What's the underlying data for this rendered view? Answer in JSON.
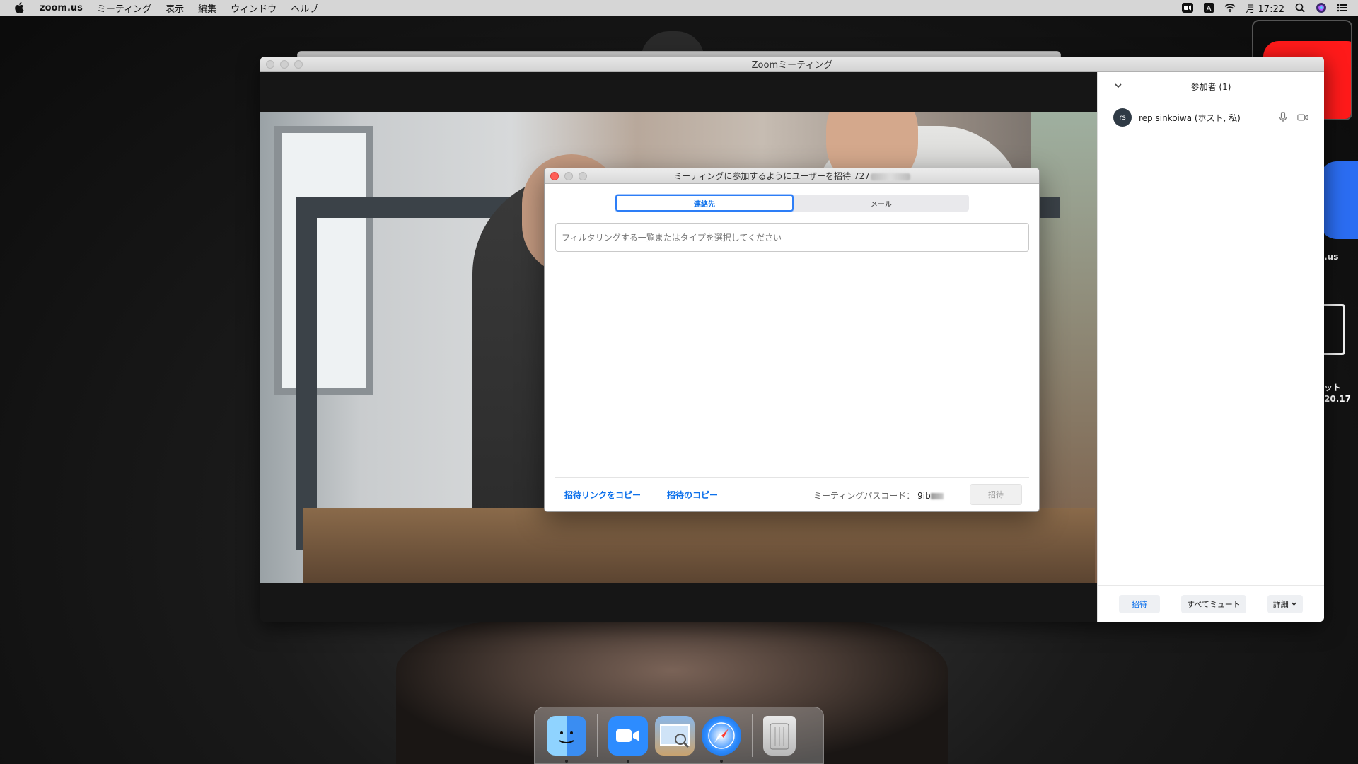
{
  "menubar": {
    "app_name": "zoom.us",
    "menus": [
      "ミーティング",
      "表示",
      "編集",
      "ウィンドウ",
      "ヘルプ"
    ],
    "clock": "月 17:22",
    "status_icons": [
      "zoom-icon",
      "input-source-icon",
      "wifi-icon",
      "spotlight-icon",
      "siri-icon",
      "control-center-icon"
    ]
  },
  "desktop": {
    "label1": "a.us",
    "label2_line1": "ット",
    "label2_line2": "20.17"
  },
  "zoom_window": {
    "title": "Zoomミーティング"
  },
  "participants": {
    "header": "参加者 (1)",
    "list": [
      {
        "initials": "rs",
        "name": "rep sinkoiwa (ホスト, 私)"
      }
    ],
    "footer": {
      "invite": "招待",
      "mute_all": "すべてミュート",
      "more": "詳細"
    }
  },
  "invite_dialog": {
    "title": "ミーティングに参加するようにユーザーを招待 727",
    "tabs": [
      {
        "label": "連絡先",
        "active": true
      },
      {
        "label": "メール",
        "active": false
      }
    ],
    "filter_placeholder": "フィルタリングする一覧またはタイプを選択してください",
    "copy_link": "招待リンクをコピー",
    "copy_invitation": "招待のコピー",
    "passcode_label": "ミーティングパスコード：",
    "passcode_value": "9ib",
    "invite_button": "招待"
  },
  "dock": {
    "apps": [
      "finder-icon",
      "zoom-app-icon",
      "preview-icon",
      "safari-icon",
      "trash-icon"
    ]
  },
  "colors": {
    "accent": "#0e71eb",
    "menubar": "#d6d6d6",
    "avatar": "#2f3a45"
  }
}
